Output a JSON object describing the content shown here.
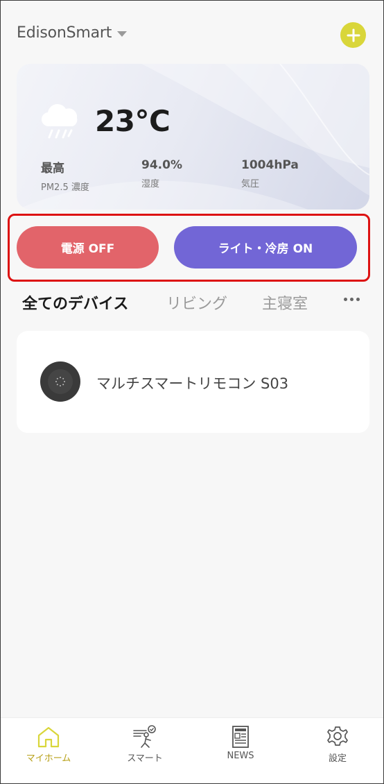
{
  "header": {
    "home_name": "EdisonSmart",
    "add_icon": "plus-icon"
  },
  "weather": {
    "icon": "rain-cloud-icon",
    "temperature": "23°C",
    "stats": [
      {
        "value": "最高",
        "label": "PM2.5 濃度"
      },
      {
        "value": "94.0%",
        "label": "湿度"
      },
      {
        "value": "1004hPa",
        "label": "気圧"
      }
    ]
  },
  "actions": {
    "power_off_label": "電源 OFF",
    "light_cool_on_label": "ライト・冷房 ON",
    "power_off_color": "#e2646a",
    "light_cool_on_color": "#7266d6",
    "highlight_color": "#dd1212"
  },
  "rooms": {
    "tabs": [
      "全てのデバイス",
      "リビング",
      "主寝室"
    ],
    "active_index": 0,
    "more_icon": "more-horizontal-icon"
  },
  "devices": [
    {
      "name": "マルチスマートリモコン S03",
      "icon": "remote-hub-icon"
    }
  ],
  "bottom_nav": {
    "items": [
      {
        "label": "マイホーム",
        "icon": "home-icon",
        "active": true
      },
      {
        "label": "スマート",
        "icon": "smart-scene-icon",
        "active": false
      },
      {
        "label": "NEWS",
        "icon": "newspaper-icon",
        "active": false
      },
      {
        "label": "設定",
        "icon": "gear-icon",
        "active": false
      }
    ],
    "accent_color": "#d9d63a"
  }
}
